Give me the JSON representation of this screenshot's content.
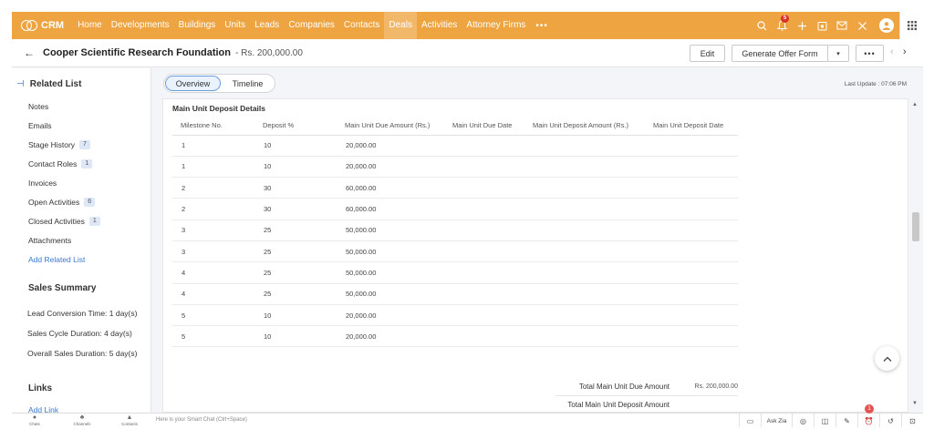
{
  "topnav": {
    "brand": "CRM",
    "items": [
      {
        "label": "Home"
      },
      {
        "label": "Developments"
      },
      {
        "label": "Buildings"
      },
      {
        "label": "Units"
      },
      {
        "label": "Leads"
      },
      {
        "label": "Companies"
      },
      {
        "label": "Contacts"
      },
      {
        "label": "Deals",
        "active": true
      },
      {
        "label": "Activities"
      },
      {
        "label": "Attorney Firms"
      }
    ],
    "more": "•••",
    "notification_count": "5",
    "icons": [
      "search-icon",
      "bell-icon",
      "plus-icon",
      "calendar-icon",
      "mail-icon",
      "tools-icon",
      "user-avatar",
      "apps-grid-icon"
    ]
  },
  "header": {
    "back": "←",
    "deal_name": "Cooper Scientific Research Foundation",
    "amount": "- Rs. 200,000.00",
    "edit_label": "Edit",
    "offer_label": "Generate Offer Form",
    "dropdown": "▾",
    "more": "•••",
    "prev": "‹",
    "next": "›"
  },
  "sidebar": {
    "related_list_title": "Related List",
    "links": [
      {
        "label": "Notes",
        "badge": ""
      },
      {
        "label": "Emails",
        "badge": ""
      },
      {
        "label": "Stage History",
        "badge": "7"
      },
      {
        "label": "Contact Roles",
        "badge": "1"
      },
      {
        "label": "Invoices",
        "badge": ""
      },
      {
        "label": "Open Activities",
        "badge": "6"
      },
      {
        "label": "Closed Activities",
        "badge": "1"
      },
      {
        "label": "Attachments",
        "badge": ""
      }
    ],
    "add_related": "Add Related List",
    "sales_summary_title": "Sales Summary",
    "summary": [
      {
        "text": "Lead Conversion Time: 1 day(s)"
      },
      {
        "text": "Sales Cycle Duration: 4 day(s)"
      },
      {
        "text": "Overall Sales Duration: 5 day(s)"
      }
    ],
    "links_title": "Links",
    "add_link": "Add Link"
  },
  "tabs": {
    "overview": "Overview",
    "timeline": "Timeline"
  },
  "last_update": "Last Update : 07:06 PM",
  "deposit": {
    "title": "Main Unit Deposit Details",
    "columns": [
      "Milestone No.",
      "Deposit %",
      "Main Unit Due Amount (Rs.)",
      "Main Unit Due Date",
      "Main Unit Deposit Amount (Rs.)",
      "Main Unit Deposit Date"
    ],
    "rows": [
      {
        "milestone": "1",
        "deposit": "10",
        "due_amount": "20,000.00",
        "due_date": "",
        "deposit_amount": "",
        "deposit_date": ""
      },
      {
        "milestone": "1",
        "deposit": "10",
        "due_amount": "20,000.00",
        "due_date": "",
        "deposit_amount": "",
        "deposit_date": ""
      },
      {
        "milestone": "2",
        "deposit": "30",
        "due_amount": "60,000.00",
        "due_date": "",
        "deposit_amount": "",
        "deposit_date": ""
      },
      {
        "milestone": "2",
        "deposit": "30",
        "due_amount": "60,000.00",
        "due_date": "",
        "deposit_amount": "",
        "deposit_date": ""
      },
      {
        "milestone": "3",
        "deposit": "25",
        "due_amount": "50,000.00",
        "due_date": "",
        "deposit_amount": "",
        "deposit_date": ""
      },
      {
        "milestone": "3",
        "deposit": "25",
        "due_amount": "50,000.00",
        "due_date": "",
        "deposit_amount": "",
        "deposit_date": ""
      },
      {
        "milestone": "4",
        "deposit": "25",
        "due_amount": "50,000.00",
        "due_date": "",
        "deposit_amount": "",
        "deposit_date": ""
      },
      {
        "milestone": "4",
        "deposit": "25",
        "due_amount": "50,000.00",
        "due_date": "",
        "deposit_amount": "",
        "deposit_date": ""
      },
      {
        "milestone": "5",
        "deposit": "10",
        "due_amount": "20,000.00",
        "due_date": "",
        "deposit_amount": "",
        "deposit_date": ""
      },
      {
        "milestone": "5",
        "deposit": "10",
        "due_amount": "20,000.00",
        "due_date": "",
        "deposit_amount": "",
        "deposit_date": ""
      }
    ],
    "totals": [
      {
        "label": "Total Main Unit Due Amount",
        "value": "Rs. 200,000.00"
      },
      {
        "label": "Total Main Unit Deposit Amount",
        "value": ""
      }
    ]
  },
  "bottombar": {
    "items": [
      {
        "label": "Chats",
        "icon": "chat-icon"
      },
      {
        "label": "Channels",
        "icon": "channels-icon"
      },
      {
        "label": "Contacts",
        "icon": "contacts-icon"
      }
    ],
    "smart_chat_placeholder": "Here is your Smart Chat (Ctrl+Space)",
    "ask_zia": "Ask Zia",
    "alarm_count": "1"
  },
  "colors": {
    "nav_orange": "#eda441",
    "link_blue": "#3a78cf",
    "badge_red": "#d7322d"
  }
}
